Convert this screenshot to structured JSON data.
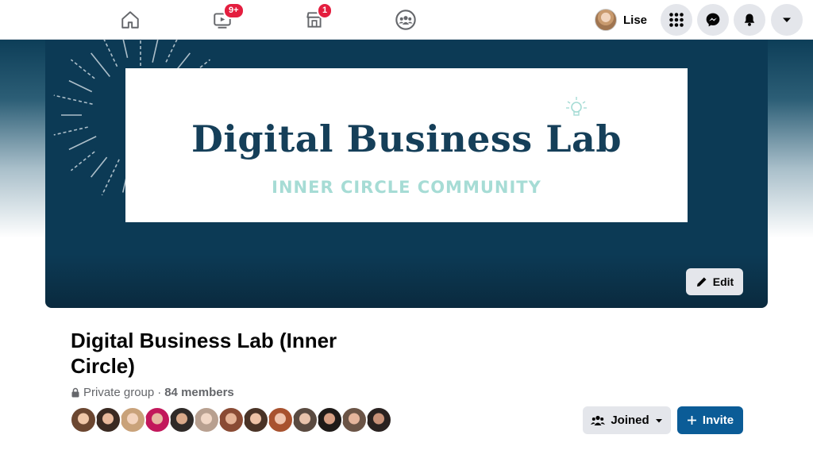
{
  "nav": {
    "watch_badge": "9+",
    "marketplace_badge": "1",
    "profile_name": "Lise"
  },
  "cover": {
    "title": "Digital Business Lab",
    "subtitle": "INNER CIRCLE COMMUNITY",
    "edit_label": "Edit"
  },
  "group": {
    "name": "Digital Business Lab (Inner Circle)",
    "privacy": "Private group",
    "separator": "·",
    "members": "84 members",
    "member_avatar_count": 13
  },
  "actions": {
    "joined_label": "Joined",
    "invite_label": "Invite"
  },
  "icons": {
    "home": "home-icon",
    "watch": "video-icon",
    "marketplace": "store-icon",
    "groups": "groups-icon",
    "menu": "grid-icon",
    "messenger": "messenger-icon",
    "notifications": "bell-icon",
    "account": "caret-down-icon",
    "lock": "lock-icon",
    "edit": "pencil-icon",
    "joined": "people-icon",
    "invite": "plus-icon"
  },
  "colors": {
    "accent": "#0b5c97",
    "badge": "#e41e3f",
    "cover_bg": "#0c3a55"
  }
}
